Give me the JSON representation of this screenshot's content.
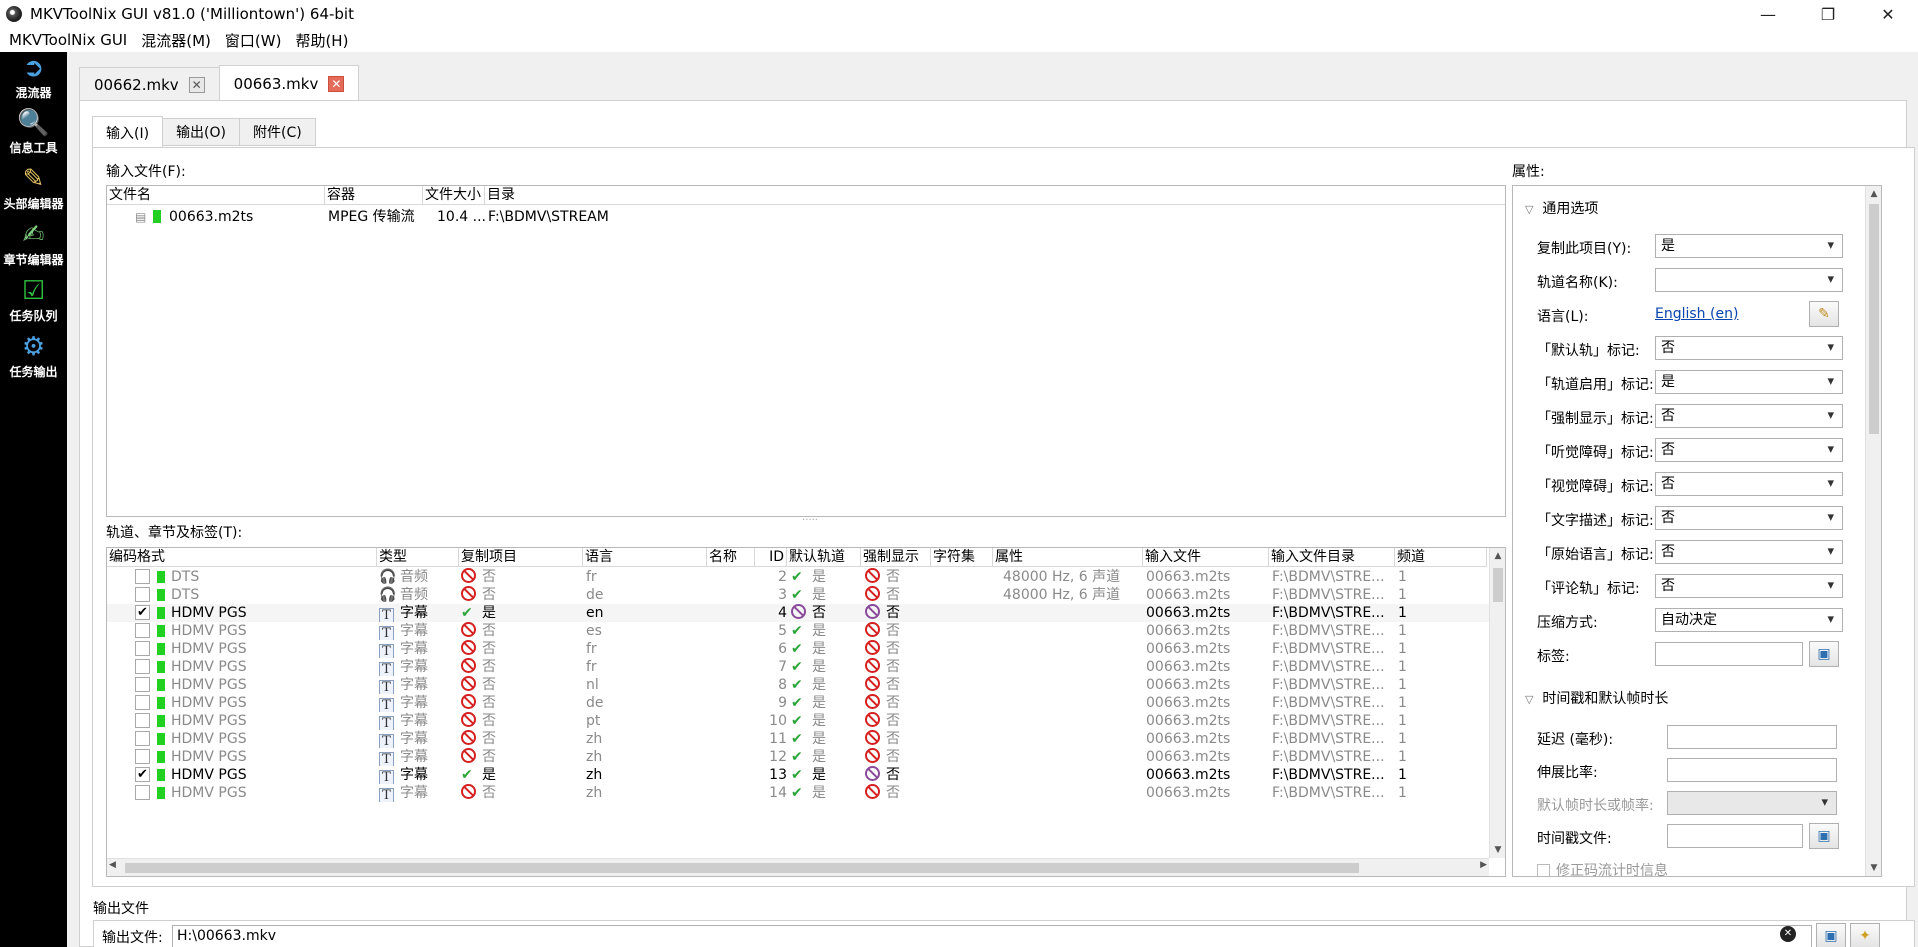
{
  "window": {
    "title": "MKVToolNix GUI v81.0 ('Milliontown') 64-bit",
    "minimize": "—",
    "maximize": "❐",
    "close": "✕"
  },
  "menu": [
    "MKVToolNix GUI",
    "混流器(M)",
    "窗口(W)",
    "帮助(H)"
  ],
  "sidebar": [
    {
      "label": "混流器",
      "icon": "mux-icon"
    },
    {
      "label": "信息工具",
      "icon": "info-tool-icon"
    },
    {
      "label": "头部编辑器",
      "icon": "header-editor-icon"
    },
    {
      "label": "章节编辑器",
      "icon": "chapter-editor-icon"
    },
    {
      "label": "任务队列",
      "icon": "job-queue-icon"
    },
    {
      "label": "任务输出",
      "icon": "job-output-icon"
    }
  ],
  "doc_tabs": [
    {
      "label": "00662.mkv",
      "active": false
    },
    {
      "label": "00663.mkv",
      "active": true
    }
  ],
  "sub_tabs": [
    {
      "label": "输入(I)",
      "active": true
    },
    {
      "label": "输出(O)",
      "active": false
    },
    {
      "label": "附件(C)",
      "active": false
    }
  ],
  "input_files": {
    "label": "输入文件(F):",
    "headers": [
      "文件名",
      "容器",
      "文件大小",
      "目录"
    ],
    "rows": [
      {
        "name": "00663.m2ts",
        "container": "MPEG 传输流",
        "size": "10.4 ...",
        "dir": "F:\\BDMV\\STREAM"
      }
    ]
  },
  "tracks": {
    "label": "轨道、章节及标签(T):",
    "headers": [
      "编码格式",
      "类型",
      "复制项目",
      "语言",
      "名称",
      "ID",
      "默认轨道",
      "强制显示",
      "字符集",
      "属性",
      "输入文件",
      "输入文件目录",
      "频道"
    ],
    "rows": [
      {
        "checked": false,
        "codec": "DTS",
        "type": "音频",
        "type_icon": "headphones",
        "copy": "否",
        "lang": "fr",
        "id": "2",
        "def": "是",
        "forced": "否",
        "props": "48000 Hz, 6 声道",
        "file": "00663.m2ts",
        "dir": "F:\\BDMV\\STRE...",
        "ch": "1"
      },
      {
        "checked": false,
        "codec": "DTS",
        "type": "音频",
        "type_icon": "headphones",
        "copy": "否",
        "lang": "de",
        "id": "3",
        "def": "是",
        "forced": "否",
        "props": "48000 Hz, 6 声道",
        "file": "00663.m2ts",
        "dir": "F:\\BDMV\\STRE...",
        "ch": "1"
      },
      {
        "checked": true,
        "codec": "HDMV PGS",
        "type": "字幕",
        "type_icon": "text",
        "copy": "是",
        "lang": "en",
        "id": "4",
        "def": "否",
        "forced": "否",
        "props": "",
        "file": "00663.m2ts",
        "dir": "F:\\BDMV\\STRE...",
        "ch": "1"
      },
      {
        "checked": false,
        "codec": "HDMV PGS",
        "type": "字幕",
        "type_icon": "text",
        "copy": "否",
        "lang": "es",
        "id": "5",
        "def": "是",
        "forced": "否",
        "props": "",
        "file": "00663.m2ts",
        "dir": "F:\\BDMV\\STRE...",
        "ch": "1"
      },
      {
        "checked": false,
        "codec": "HDMV PGS",
        "type": "字幕",
        "type_icon": "text",
        "copy": "否",
        "lang": "fr",
        "id": "6",
        "def": "是",
        "forced": "否",
        "props": "",
        "file": "00663.m2ts",
        "dir": "F:\\BDMV\\STRE...",
        "ch": "1"
      },
      {
        "checked": false,
        "codec": "HDMV PGS",
        "type": "字幕",
        "type_icon": "text",
        "copy": "否",
        "lang": "fr",
        "id": "7",
        "def": "是",
        "forced": "否",
        "props": "",
        "file": "00663.m2ts",
        "dir": "F:\\BDMV\\STRE...",
        "ch": "1"
      },
      {
        "checked": false,
        "codec": "HDMV PGS",
        "type": "字幕",
        "type_icon": "text",
        "copy": "否",
        "lang": "nl",
        "id": "8",
        "def": "是",
        "forced": "否",
        "props": "",
        "file": "00663.m2ts",
        "dir": "F:\\BDMV\\STRE...",
        "ch": "1"
      },
      {
        "checked": false,
        "codec": "HDMV PGS",
        "type": "字幕",
        "type_icon": "text",
        "copy": "否",
        "lang": "de",
        "id": "9",
        "def": "是",
        "forced": "否",
        "props": "",
        "file": "00663.m2ts",
        "dir": "F:\\BDMV\\STRE...",
        "ch": "1"
      },
      {
        "checked": false,
        "codec": "HDMV PGS",
        "type": "字幕",
        "type_icon": "text",
        "copy": "否",
        "lang": "pt",
        "id": "10",
        "def": "是",
        "forced": "否",
        "props": "",
        "file": "00663.m2ts",
        "dir": "F:\\BDMV\\STRE...",
        "ch": "1"
      },
      {
        "checked": false,
        "codec": "HDMV PGS",
        "type": "字幕",
        "type_icon": "text",
        "copy": "否",
        "lang": "zh",
        "id": "11",
        "def": "是",
        "forced": "否",
        "props": "",
        "file": "00663.m2ts",
        "dir": "F:\\BDMV\\STRE...",
        "ch": "1"
      },
      {
        "checked": false,
        "codec": "HDMV PGS",
        "type": "字幕",
        "type_icon": "text",
        "copy": "否",
        "lang": "zh",
        "id": "12",
        "def": "是",
        "forced": "否",
        "props": "",
        "file": "00663.m2ts",
        "dir": "F:\\BDMV\\STRE...",
        "ch": "1"
      },
      {
        "checked": true,
        "codec": "HDMV PGS",
        "type": "字幕",
        "type_icon": "text",
        "copy": "是",
        "lang": "zh",
        "id": "13",
        "def": "是",
        "forced": "否",
        "props": "",
        "file": "00663.m2ts",
        "dir": "F:\\BDMV\\STRE...",
        "ch": "1"
      },
      {
        "checked": false,
        "codec": "HDMV PGS",
        "type": "字幕",
        "type_icon": "text",
        "copy": "否",
        "lang": "zh",
        "id": "14",
        "def": "是",
        "forced": "否",
        "props": "",
        "file": "00663.m2ts",
        "dir": "F:\\BDMV\\STRE...",
        "ch": "1"
      }
    ]
  },
  "properties": {
    "label": "属性:",
    "general_group": "通用选项",
    "copy_item_label": "复制此项目(Y):",
    "copy_item_value": "是",
    "track_name_label": "轨道名称(K):",
    "track_name_value": "",
    "language_label": "语言(L):",
    "language_value": "English (en)",
    "default_label": "「默认轨」标记:",
    "default_value": "否",
    "enabled_label": "「轨道启用」标记:",
    "enabled_value": "是",
    "forced_label": "「强制显示」标记:",
    "forced_value": "否",
    "hearing_label": "「听觉障碍」标记:",
    "hearing_value": "否",
    "visual_label": "「视觉障碍」标记:",
    "visual_value": "否",
    "textdesc_label": "「文字描述」标记:",
    "textdesc_value": "否",
    "original_label": "「原始语言」标记:",
    "original_value": "否",
    "commentary_label": "「评论轨」标记:",
    "commentary_value": "否",
    "compression_label": "压缩方式:",
    "compression_value": "自动决定",
    "tags_label": "标签:",
    "timing_group": "时间戳和默认帧时长",
    "delay_label": "延迟 (毫秒):",
    "stretch_label": "伸展比率:",
    "fps_label": "默认帧时长或帧率:",
    "timestamp_file_label": "时间戳文件:",
    "fix_bitstream_label": "修正码流计时信息"
  },
  "output": {
    "section_label": "输出文件",
    "field_label": "输出文件:",
    "value": "H:\\00663.mkv"
  }
}
